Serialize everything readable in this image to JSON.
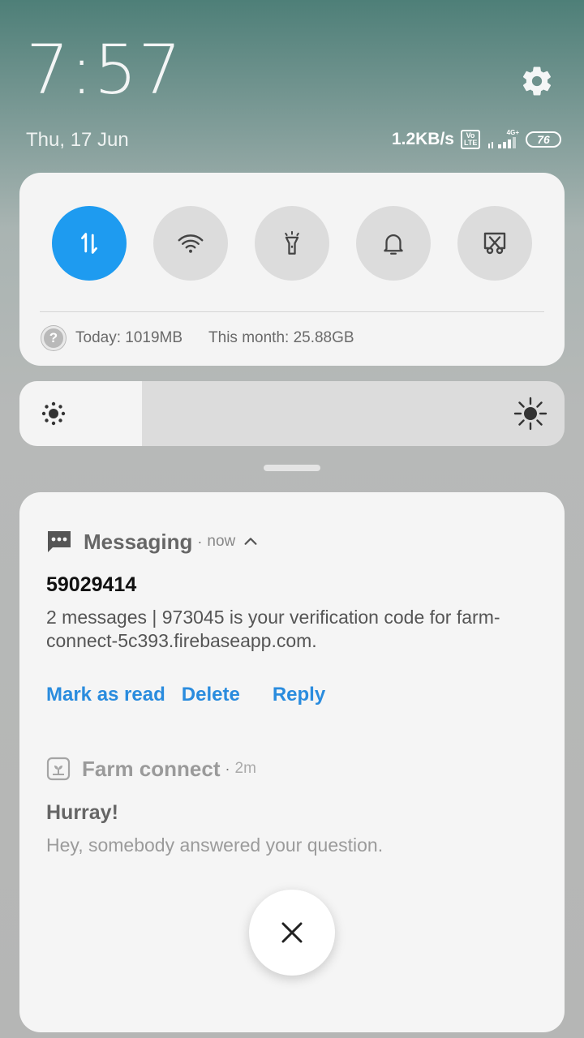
{
  "header": {
    "clock": "7:57",
    "date": "Thu, 17 Jun",
    "settings_icon": "gear-icon"
  },
  "status": {
    "net_speed": "1.2KB/s",
    "volte_top": "Vo",
    "volte_bottom": "LTE",
    "signal_tag": "4G+",
    "battery": "76"
  },
  "quick_settings": {
    "toggles": [
      {
        "icon": "mobile-data-icon",
        "active": true
      },
      {
        "icon": "wifi-icon",
        "active": false
      },
      {
        "icon": "flashlight-icon",
        "active": false
      },
      {
        "icon": "bell-icon",
        "active": false
      },
      {
        "icon": "screenshot-icon",
        "active": false
      }
    ],
    "usage_today": "Today: 1019MB",
    "usage_month": "This month: 25.88GB",
    "help_glyph": "?"
  },
  "brightness": {
    "level": 0.225
  },
  "notifications": [
    {
      "app": "Messaging",
      "time": "now",
      "sender": "59029414",
      "body": "2 messages | 973045 is your verification code for farm-connect-5c393.firebaseapp.com.",
      "actions": [
        "Mark as read",
        "Delete",
        "Reply"
      ]
    },
    {
      "app": "Farm connect",
      "time": "2m",
      "title": "Hurray!",
      "body": "Hey, somebody answered your question."
    }
  ],
  "separator": "·",
  "colors": {
    "accent": "#1e9bf0",
    "action_link": "#2a8cde"
  }
}
